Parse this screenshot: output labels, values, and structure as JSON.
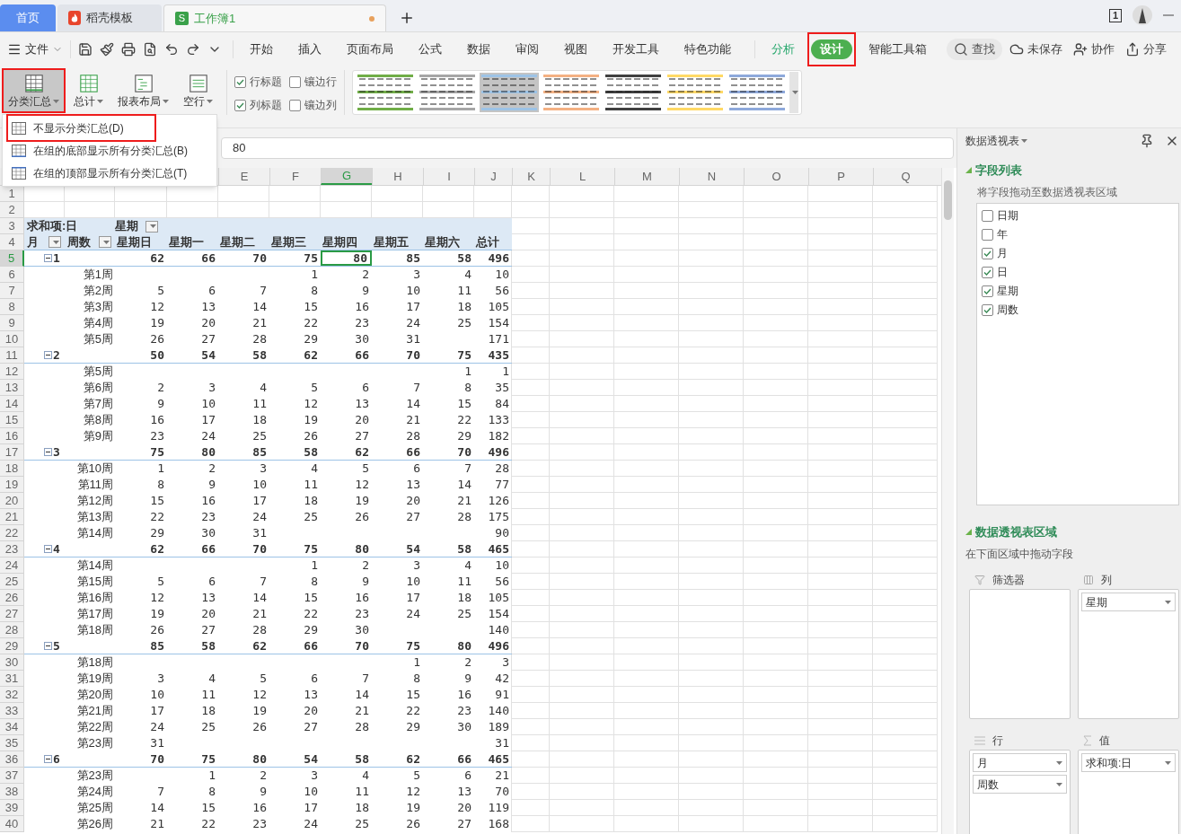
{
  "tabs": [
    {
      "kind": "home",
      "label": "首页",
      "selected": false
    },
    {
      "kind": "docer",
      "label": "稻壳模板",
      "selected": false
    },
    {
      "kind": "sheet",
      "label": "工作簿1",
      "icon_text": "S",
      "modified": true,
      "selected": true
    }
  ],
  "window_count": "1",
  "menu": {
    "file": "文件",
    "tabs": [
      {
        "label": "开始",
        "kind": "normal",
        "selected": false,
        "highlighted": false
      },
      {
        "label": "插入",
        "kind": "normal",
        "selected": false,
        "highlighted": false
      },
      {
        "label": "页面布局",
        "kind": "normal",
        "selected": false,
        "highlighted": false
      },
      {
        "label": "公式",
        "kind": "normal",
        "selected": false,
        "highlighted": false
      },
      {
        "label": "数据",
        "kind": "normal",
        "selected": false,
        "highlighted": false
      },
      {
        "label": "审阅",
        "kind": "normal",
        "selected": false,
        "highlighted": false
      },
      {
        "label": "视图",
        "kind": "normal",
        "selected": false,
        "highlighted": false
      },
      {
        "label": "开发工具",
        "kind": "normal",
        "selected": false,
        "highlighted": false
      },
      {
        "label": "特色功能",
        "kind": "normal",
        "selected": false,
        "highlighted": false
      },
      {
        "label": "分析",
        "kind": "context",
        "selected": false,
        "highlighted": false
      },
      {
        "label": "设计",
        "kind": "context",
        "selected": true,
        "highlighted": true
      },
      {
        "label": "智能工具箱",
        "kind": "normal",
        "selected": false,
        "highlighted": false
      }
    ],
    "search": "查找",
    "actions": [
      {
        "kind": "cloud",
        "label": "未保存"
      },
      {
        "kind": "collab",
        "label": "协作"
      },
      {
        "kind": "share",
        "label": "分享"
      }
    ]
  },
  "ribbon": {
    "buttons": [
      {
        "kind": "subtotal",
        "label": "分类汇总",
        "selected": true,
        "highlighted": true
      },
      {
        "kind": "total",
        "label": "总计",
        "selected": false,
        "highlighted": false
      },
      {
        "kind": "layout",
        "label": "报表布局",
        "selected": false,
        "highlighted": false
      },
      {
        "kind": "blank",
        "label": "空行",
        "selected": false,
        "highlighted": false
      }
    ],
    "checkboxes": [
      {
        "label": "行标题",
        "checked": true
      },
      {
        "label": "镶边行",
        "checked": false
      },
      {
        "label": "列标题",
        "checked": true
      },
      {
        "label": "镶边列",
        "checked": false
      }
    ],
    "styles": [
      {
        "color": "#70ad47",
        "selected": false
      },
      {
        "color": "#a6a6a6",
        "selected": false
      },
      {
        "color": "#9dc3e6",
        "selected": true
      },
      {
        "color": "#f4b183",
        "selected": false
      },
      {
        "color": "#404040",
        "selected": false
      },
      {
        "color": "#ffd966",
        "selected": false
      },
      {
        "color": "#8ea9db",
        "selected": false
      }
    ]
  },
  "dropdown": [
    {
      "kind": "none",
      "label": "不显示分类汇总(D)",
      "highlighted": true
    },
    {
      "kind": "bottom",
      "label": "在组的底部显示所有分类汇总(B)",
      "highlighted": false
    },
    {
      "kind": "top",
      "label": "在组的顶部显示所有分类汇总(T)",
      "highlighted": false
    }
  ],
  "formula_bar": {
    "value": "80"
  },
  "columns": [
    {
      "label": "E",
      "selected": false
    },
    {
      "label": "F",
      "selected": false
    },
    {
      "label": "G",
      "selected": true
    },
    {
      "label": "H",
      "selected": false
    },
    {
      "label": "I",
      "selected": false
    },
    {
      "label": "J",
      "selected": false
    },
    {
      "label": "K",
      "selected": false
    },
    {
      "label": "L",
      "selected": false
    },
    {
      "label": "M",
      "selected": false
    },
    {
      "label": "N",
      "selected": false
    },
    {
      "label": "O",
      "selected": false
    },
    {
      "label": "P",
      "selected": false
    },
    {
      "label": "Q",
      "selected": false
    }
  ],
  "row_headers": [
    {
      "label": "1",
      "selected": false
    },
    {
      "label": "2",
      "selected": false
    },
    {
      "label": "3",
      "selected": false
    },
    {
      "label": "4",
      "selected": false
    },
    {
      "label": "5",
      "selected": true
    },
    {
      "label": "6",
      "selected": false
    },
    {
      "label": "7",
      "selected": false
    },
    {
      "label": "8",
      "selected": false
    },
    {
      "label": "9",
      "selected": false
    },
    {
      "label": "10",
      "selected": false
    },
    {
      "label": "11",
      "selected": false
    },
    {
      "label": "12",
      "selected": false
    },
    {
      "label": "13",
      "selected": false
    },
    {
      "label": "14",
      "selected": false
    },
    {
      "label": "15",
      "selected": false
    },
    {
      "label": "16",
      "selected": false
    },
    {
      "label": "17",
      "selected": false
    },
    {
      "label": "18",
      "selected": false
    },
    {
      "label": "19",
      "selected": false
    },
    {
      "label": "20",
      "selected": false
    },
    {
      "label": "21",
      "selected": false
    },
    {
      "label": "22",
      "selected": false
    },
    {
      "label": "23",
      "selected": false
    },
    {
      "label": "24",
      "selected": false
    },
    {
      "label": "25",
      "selected": false
    },
    {
      "label": "26",
      "selected": false
    },
    {
      "label": "27",
      "selected": false
    },
    {
      "label": "28",
      "selected": false
    },
    {
      "label": "29",
      "selected": false
    },
    {
      "label": "30",
      "selected": false
    },
    {
      "label": "31",
      "selected": false
    },
    {
      "label": "32",
      "selected": false
    },
    {
      "label": "33",
      "selected": false
    },
    {
      "label": "34",
      "selected": false
    },
    {
      "label": "35",
      "selected": false
    },
    {
      "label": "36",
      "selected": false
    },
    {
      "label": "37",
      "selected": false
    },
    {
      "label": "38",
      "selected": false
    },
    {
      "label": "39",
      "selected": false
    },
    {
      "label": "40",
      "selected": false
    }
  ],
  "pivot": {
    "value_field": "求和项:日",
    "column_field": "星期",
    "row_fields": [
      "月",
      "周数"
    ],
    "headers": [
      "星期日",
      "星期一",
      "星期二",
      "星期三",
      "星期四",
      "星期五",
      "星期六",
      "总计"
    ],
    "rows": [
      {
        "kind": "group",
        "label": "1",
        "expanded": true,
        "values": [
          "62",
          "66",
          "70",
          "75",
          "80",
          "85",
          "58",
          "496"
        ]
      },
      {
        "kind": "item",
        "label": "第1周",
        "cells": {
          "3": "1",
          "4": "2",
          "5": "3",
          "6": "4",
          "7": "10"
        }
      },
      {
        "kind": "item",
        "label": "第2周",
        "values": [
          "5",
          "6",
          "7",
          "8",
          "9",
          "10",
          "11",
          "56"
        ]
      },
      {
        "kind": "item",
        "label": "第3周",
        "values": [
          "12",
          "13",
          "14",
          "15",
          "16",
          "17",
          "18",
          "105"
        ]
      },
      {
        "kind": "item",
        "label": "第4周",
        "values": [
          "19",
          "20",
          "21",
          "22",
          "23",
          "24",
          "25",
          "154"
        ]
      },
      {
        "kind": "item",
        "label": "第5周",
        "cells": {
          "0": "26",
          "1": "27",
          "2": "28",
          "3": "29",
          "4": "30",
          "5": "31",
          "7": "171"
        }
      },
      {
        "kind": "group",
        "label": "2",
        "expanded": true,
        "values": [
          "50",
          "54",
          "58",
          "62",
          "66",
          "70",
          "75",
          "435"
        ]
      },
      {
        "kind": "item",
        "label": "第5周",
        "cells": {
          "6": "1",
          "7": "1"
        }
      },
      {
        "kind": "item",
        "label": "第6周",
        "values": [
          "2",
          "3",
          "4",
          "5",
          "6",
          "7",
          "8",
          "35"
        ]
      },
      {
        "kind": "item",
        "label": "第7周",
        "values": [
          "9",
          "10",
          "11",
          "12",
          "13",
          "14",
          "15",
          "84"
        ]
      },
      {
        "kind": "item",
        "label": "第8周",
        "values": [
          "16",
          "17",
          "18",
          "19",
          "20",
          "21",
          "22",
          "133"
        ]
      },
      {
        "kind": "item",
        "label": "第9周",
        "values": [
          "23",
          "24",
          "25",
          "26",
          "27",
          "28",
          "29",
          "182"
        ]
      },
      {
        "kind": "group",
        "label": "3",
        "expanded": true,
        "values": [
          "75",
          "80",
          "85",
          "58",
          "62",
          "66",
          "70",
          "496"
        ]
      },
      {
        "kind": "item",
        "label": "第10周",
        "values": [
          "1",
          "2",
          "3",
          "4",
          "5",
          "6",
          "7",
          "28"
        ]
      },
      {
        "kind": "item",
        "label": "第11周",
        "values": [
          "8",
          "9",
          "10",
          "11",
          "12",
          "13",
          "14",
          "77"
        ]
      },
      {
        "kind": "item",
        "label": "第12周",
        "values": [
          "15",
          "16",
          "17",
          "18",
          "19",
          "20",
          "21",
          "126"
        ]
      },
      {
        "kind": "item",
        "label": "第13周",
        "values": [
          "22",
          "23",
          "24",
          "25",
          "26",
          "27",
          "28",
          "175"
        ]
      },
      {
        "kind": "item",
        "label": "第14周",
        "cells": {
          "0": "29",
          "1": "30",
          "2": "31",
          "7": "90"
        }
      },
      {
        "kind": "group",
        "label": "4",
        "expanded": true,
        "values": [
          "62",
          "66",
          "70",
          "75",
          "80",
          "54",
          "58",
          "465"
        ]
      },
      {
        "kind": "item",
        "label": "第14周",
        "cells": {
          "3": "1",
          "4": "2",
          "5": "3",
          "6": "4",
          "7": "10"
        }
      },
      {
        "kind": "item",
        "label": "第15周",
        "values": [
          "5",
          "6",
          "7",
          "8",
          "9",
          "10",
          "11",
          "56"
        ]
      },
      {
        "kind": "item",
        "label": "第16周",
        "values": [
          "12",
          "13",
          "14",
          "15",
          "16",
          "17",
          "18",
          "105"
        ]
      },
      {
        "kind": "item",
        "label": "第17周",
        "values": [
          "19",
          "20",
          "21",
          "22",
          "23",
          "24",
          "25",
          "154"
        ]
      },
      {
        "kind": "item",
        "label": "第18周",
        "cells": {
          "0": "26",
          "1": "27",
          "2": "28",
          "3": "29",
          "4": "30",
          "7": "140"
        }
      },
      {
        "kind": "group",
        "label": "5",
        "expanded": true,
        "values": [
          "85",
          "58",
          "62",
          "66",
          "70",
          "75",
          "80",
          "496"
        ]
      },
      {
        "kind": "item",
        "label": "第18周",
        "cells": {
          "5": "1",
          "6": "2",
          "7": "3"
        }
      },
      {
        "kind": "item",
        "label": "第19周",
        "values": [
          "3",
          "4",
          "5",
          "6",
          "7",
          "8",
          "9",
          "42"
        ]
      },
      {
        "kind": "item",
        "label": "第20周",
        "values": [
          "10",
          "11",
          "12",
          "13",
          "14",
          "15",
          "16",
          "91"
        ]
      },
      {
        "kind": "item",
        "label": "第21周",
        "values": [
          "17",
          "18",
          "19",
          "20",
          "21",
          "22",
          "23",
          "140"
        ]
      },
      {
        "kind": "item",
        "label": "第22周",
        "values": [
          "24",
          "25",
          "26",
          "27",
          "28",
          "29",
          "30",
          "189"
        ]
      },
      {
        "kind": "item",
        "label": "第23周",
        "cells": {
          "0": "31",
          "7": "31"
        }
      },
      {
        "kind": "group",
        "label": "6",
        "expanded": true,
        "values": [
          "70",
          "75",
          "80",
          "54",
          "58",
          "62",
          "66",
          "465"
        ]
      },
      {
        "kind": "item",
        "label": "第23周",
        "cells": {
          "1": "1",
          "2": "2",
          "3": "3",
          "4": "4",
          "5": "5",
          "6": "6",
          "7": "21"
        }
      },
      {
        "kind": "item",
        "label": "第24周",
        "values": [
          "7",
          "8",
          "9",
          "10",
          "11",
          "12",
          "13",
          "70"
        ]
      },
      {
        "kind": "item",
        "label": "第25周",
        "values": [
          "14",
          "15",
          "16",
          "17",
          "18",
          "19",
          "20",
          "119"
        ]
      },
      {
        "kind": "item",
        "label": "第26周",
        "values": [
          "21",
          "22",
          "23",
          "24",
          "25",
          "26",
          "27",
          "168"
        ]
      }
    ]
  },
  "panel": {
    "title": "数据透视表",
    "field_section": "字段列表",
    "field_hint": "将字段拖动至数据透视表区域",
    "fields": [
      {
        "label": "日期",
        "checked": false
      },
      {
        "label": "年",
        "checked": false
      },
      {
        "label": "月",
        "checked": true
      },
      {
        "label": "日",
        "checked": true
      },
      {
        "label": "星期",
        "checked": true
      },
      {
        "label": "周数",
        "checked": true
      }
    ],
    "area_section": "数据透视表区域",
    "area_hint": "在下面区域中拖动字段",
    "areas": [
      {
        "kind": "filter",
        "label": "筛选器"
      },
      {
        "kind": "columns",
        "label": "列",
        "items": [
          "星期"
        ]
      },
      {
        "kind": "rows",
        "label": "行",
        "items": [
          "月",
          "周数"
        ]
      },
      {
        "kind": "values",
        "label": "值",
        "items": [
          "求和项:日"
        ]
      }
    ]
  }
}
